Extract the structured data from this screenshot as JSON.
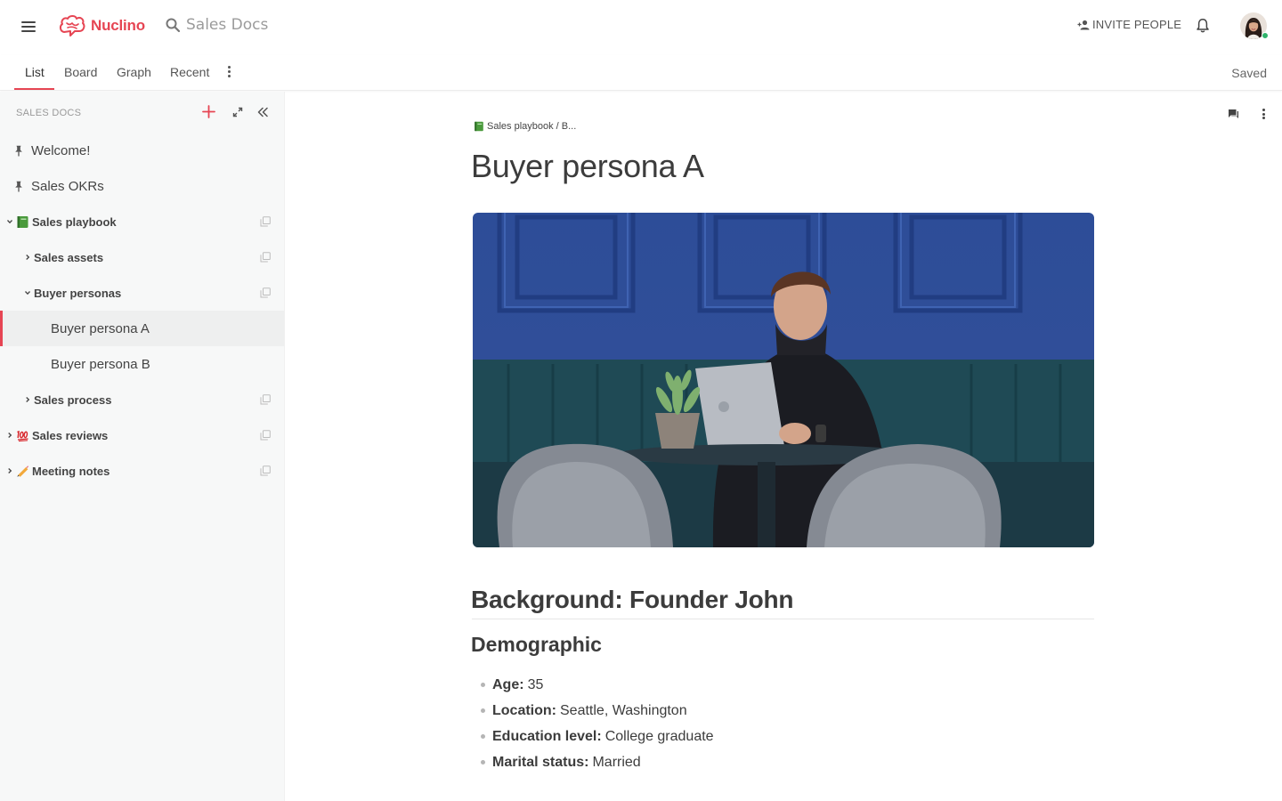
{
  "brand": {
    "name": "Nuclino",
    "color": "#e64553"
  },
  "search": {
    "label": "Sales Docs"
  },
  "header": {
    "invite_label": "INVITE PEOPLE"
  },
  "tabs": [
    {
      "label": "List",
      "active": true
    },
    {
      "label": "Board"
    },
    {
      "label": "Graph"
    },
    {
      "label": "Recent"
    }
  ],
  "status": {
    "saved": "Saved"
  },
  "sidebar": {
    "title": "SALES DOCS",
    "items": [
      {
        "label": "Welcome!",
        "icon": "pin-icon"
      },
      {
        "label": "Sales OKRs",
        "icon": "pin-icon"
      },
      {
        "label": "Sales playbook",
        "icon": "green-book-icon",
        "expanded": true
      },
      {
        "label": "Sales assets",
        "collapsed": true
      },
      {
        "label": "Buyer personas",
        "expanded": true
      },
      {
        "label": "Buyer persona A",
        "selected": true
      },
      {
        "label": "Buyer persona B"
      },
      {
        "label": "Sales process",
        "collapsed": true
      },
      {
        "label": "Sales reviews",
        "icon": "hundred-points-icon",
        "collapsed": true
      },
      {
        "label": "Meeting notes",
        "icon": "pencil-icon",
        "collapsed": true
      }
    ]
  },
  "document": {
    "breadcrumb": "Sales playbook / B...",
    "title": "Buyer persona A",
    "image_alt": "Man working on a laptop at a table in front of a blue paneled wall",
    "heading": "Background: Founder John",
    "subheading": "Demographic",
    "facts": [
      {
        "key": "Age:",
        "value": "35"
      },
      {
        "key": "Location:",
        "value": "Seattle, Washington"
      },
      {
        "key": "Education level:",
        "value": "College graduate"
      },
      {
        "key": "Marital status:",
        "value": "Married"
      }
    ]
  }
}
